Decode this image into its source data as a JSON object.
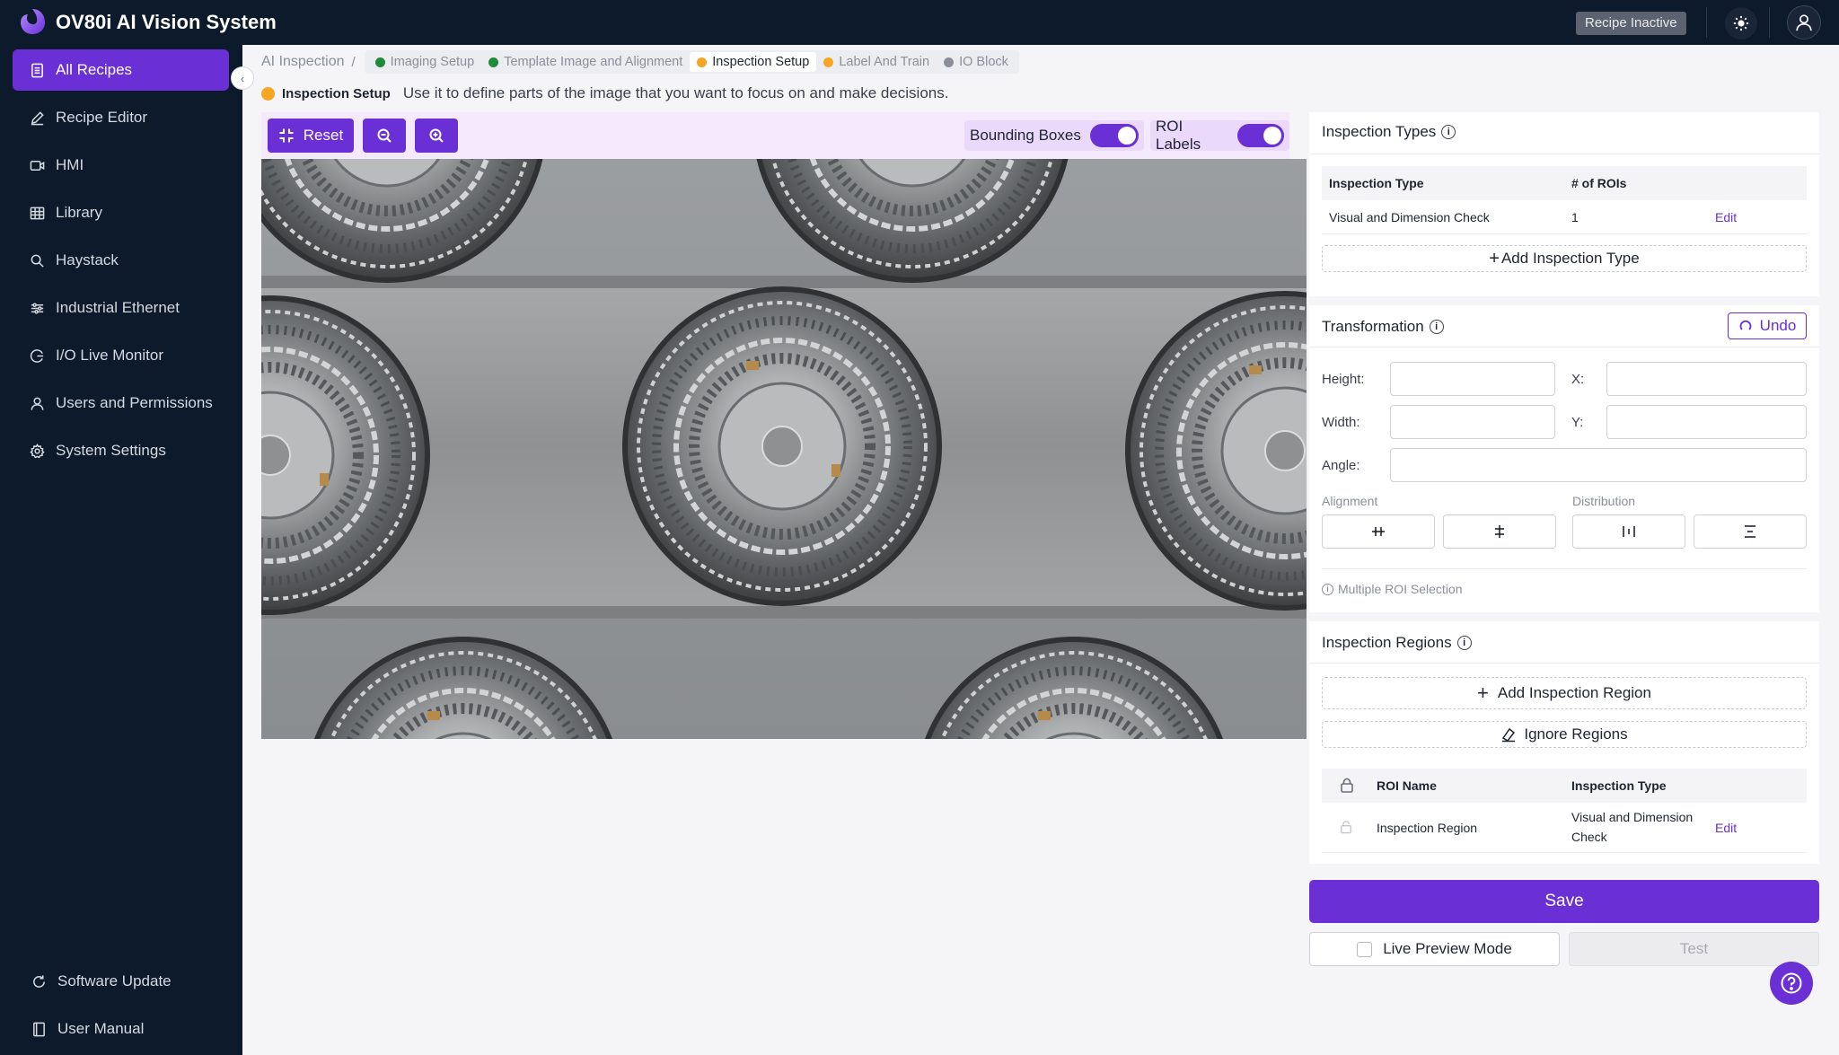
{
  "app": {
    "title": "OV80i AI Vision System",
    "recipe_status": "Recipe Inactive"
  },
  "sidebar": {
    "items": [
      {
        "label": "All Recipes",
        "icon": "document-icon",
        "active": true
      },
      {
        "label": "Recipe Editor",
        "icon": "pencil-icon"
      },
      {
        "label": "HMI",
        "icon": "video-icon"
      },
      {
        "label": "Library",
        "icon": "grid-icon"
      },
      {
        "label": "Haystack",
        "icon": "search-icon"
      },
      {
        "label": "Industrial Ethernet",
        "icon": "ethernet-icon"
      },
      {
        "label": "I/O Live Monitor",
        "icon": "monitor-icon"
      },
      {
        "label": "Users and Permissions",
        "icon": "user-icon"
      },
      {
        "label": "System Settings",
        "icon": "gear-icon"
      }
    ],
    "bottom": [
      {
        "label": "Software Update",
        "icon": "refresh-icon"
      },
      {
        "label": "User Manual",
        "icon": "book-icon"
      }
    ]
  },
  "breadcrumb": {
    "root": "AI Inspection",
    "separator": "/",
    "steps": [
      {
        "label": "Imaging Setup",
        "color": "#1f8a3a"
      },
      {
        "label": "Template Image and Alignment",
        "color": "#1f8a3a"
      },
      {
        "label": "Inspection Setup",
        "color": "#f5a623",
        "current": true
      },
      {
        "label": "Label And Train",
        "color": "#f5a623"
      },
      {
        "label": "IO Block",
        "color": "#8a8f99"
      }
    ]
  },
  "hint": {
    "label": "Inspection Setup",
    "text": "Use it to define parts of the image that you want to focus on and make decisions."
  },
  "toolbar": {
    "reset_label": "Reset",
    "bounding_boxes_label": "Bounding Boxes",
    "bounding_boxes_on": true,
    "roi_labels_label": "ROI Labels",
    "roi_labels_on": true
  },
  "inspection_types": {
    "title": "Inspection Types",
    "columns": [
      "Inspection Type",
      "# of ROIs"
    ],
    "rows": [
      {
        "type": "Visual and Dimension Check",
        "count": "1",
        "action": "Edit"
      }
    ],
    "add_label": "Add Inspection Type"
  },
  "transformation": {
    "title": "Transformation",
    "undo_label": "Undo",
    "height_label": "Height:",
    "height_value": "",
    "width_label": "Width:",
    "width_value": "",
    "x_label": "X:",
    "x_value": "",
    "y_label": "Y:",
    "y_value": "",
    "angle_label": "Angle:",
    "angle_value": "",
    "alignment_label": "Alignment",
    "distribution_label": "Distribution",
    "multi_roi_label": "Multiple ROI Selection"
  },
  "inspection_regions": {
    "title": "Inspection Regions",
    "add_label": "Add Inspection Region",
    "ignore_label": "Ignore Regions",
    "columns": [
      "ROI Name",
      "Inspection Type"
    ],
    "rows": [
      {
        "name": "Inspection Region",
        "type_line1": "Visual and Dimension",
        "type_line2": "Check",
        "action": "Edit"
      }
    ]
  },
  "actions": {
    "save_label": "Save",
    "live_preview_label": "Live Preview Mode",
    "test_label": "Test"
  },
  "colors": {
    "accent": "#6b2fd6",
    "nav_bg": "#0d1a2b",
    "status_green": "#1f8a3a",
    "status_orange": "#f5a623",
    "status_gray": "#8a8f99"
  }
}
